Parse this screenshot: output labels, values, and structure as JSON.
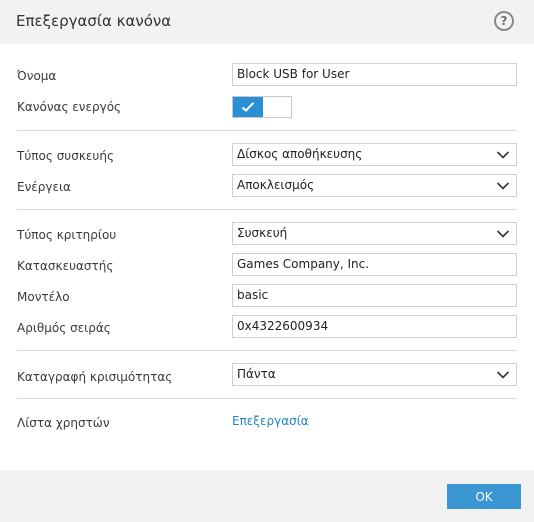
{
  "window": {
    "title": "Επεξεργασία κανόνα",
    "help_label": "?"
  },
  "fields": {
    "name_label": "Όνομα",
    "name_value": "Block USB for User",
    "enabled_label": "Κανόνας ενεργός",
    "enabled": true,
    "device_type_label": "Τύπος συσκευής",
    "device_type_value": "Δίσκος αποθήκευσης",
    "action_label": "Ενέργεια",
    "action_value": "Αποκλεισμός",
    "criteria_type_label": "Τύπος κριτηρίου",
    "criteria_type_value": "Συσκευή",
    "vendor_label": "Κατασκευαστής",
    "vendor_value": "Games Company, Inc.",
    "model_label": "Μοντέλο",
    "model_value": "basic",
    "serial_label": "Αριθμός σειράς",
    "serial_value": "0x4322600934",
    "logging_label": "Καταγραφή κρισιμότητας",
    "logging_value": "Πάντα",
    "users_label": "Λίστα χρηστών",
    "users_link": "Επεξεργασία"
  },
  "footer": {
    "ok_label": "OK"
  },
  "colors": {
    "accent": "#2b8fd6",
    "button": "#3a97d4",
    "link": "#1f87c8"
  }
}
